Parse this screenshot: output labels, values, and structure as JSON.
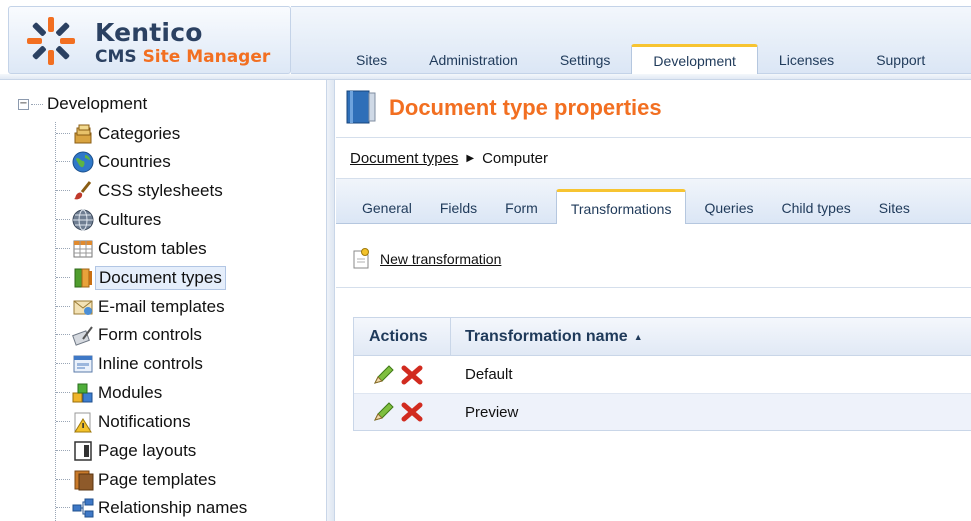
{
  "brand": {
    "title": "Kentico",
    "subtitle_part1": "CMS",
    "subtitle_part2": "Site Manager"
  },
  "top_tabs": [
    {
      "label": "Sites",
      "active": false
    },
    {
      "label": "Administration",
      "active": false
    },
    {
      "label": "Settings",
      "active": false
    },
    {
      "label": "Development",
      "active": true
    },
    {
      "label": "Licenses",
      "active": false
    },
    {
      "label": "Support",
      "active": false
    }
  ],
  "tree": {
    "root_label": "Development",
    "items": [
      {
        "label": "Categories",
        "icon": "categories-icon"
      },
      {
        "label": "Countries",
        "icon": "globe-icon"
      },
      {
        "label": "CSS stylesheets",
        "icon": "brush-icon"
      },
      {
        "label": "Cultures",
        "icon": "cultures-icon"
      },
      {
        "label": "Custom tables",
        "icon": "table-icon"
      },
      {
        "label": "Document types",
        "icon": "document-types-icon",
        "selected": true
      },
      {
        "label": "E-mail templates",
        "icon": "email-icon"
      },
      {
        "label": "Form controls",
        "icon": "form-controls-icon"
      },
      {
        "label": "Inline controls",
        "icon": "inline-controls-icon"
      },
      {
        "label": "Modules",
        "icon": "modules-icon"
      },
      {
        "label": "Notifications",
        "icon": "notifications-icon"
      },
      {
        "label": "Page layouts",
        "icon": "page-layouts-icon"
      },
      {
        "label": "Page templates",
        "icon": "page-templates-icon"
      },
      {
        "label": "Relationship names",
        "icon": "relationship-icon"
      }
    ]
  },
  "page": {
    "title": "Document type properties",
    "breadcrumb": {
      "link": "Document types",
      "current": "Computer"
    }
  },
  "sub_tabs": [
    {
      "label": "General",
      "active": false
    },
    {
      "label": "Fields",
      "active": false
    },
    {
      "label": "Form",
      "active": false
    },
    {
      "label": "Transformations",
      "active": true
    },
    {
      "label": "Queries",
      "active": false
    },
    {
      "label": "Child types",
      "active": false
    },
    {
      "label": "Sites",
      "active": false
    }
  ],
  "actions": {
    "new_label": "New transformation"
  },
  "grid": {
    "col_actions": "Actions",
    "col_name": "Transformation name",
    "rows": [
      {
        "name": "Default"
      },
      {
        "name": "Preview"
      }
    ]
  },
  "colors": {
    "accent_orange": "#f26f21",
    "tab_highlight": "#f7c431",
    "brand_navy": "#2b4162"
  }
}
